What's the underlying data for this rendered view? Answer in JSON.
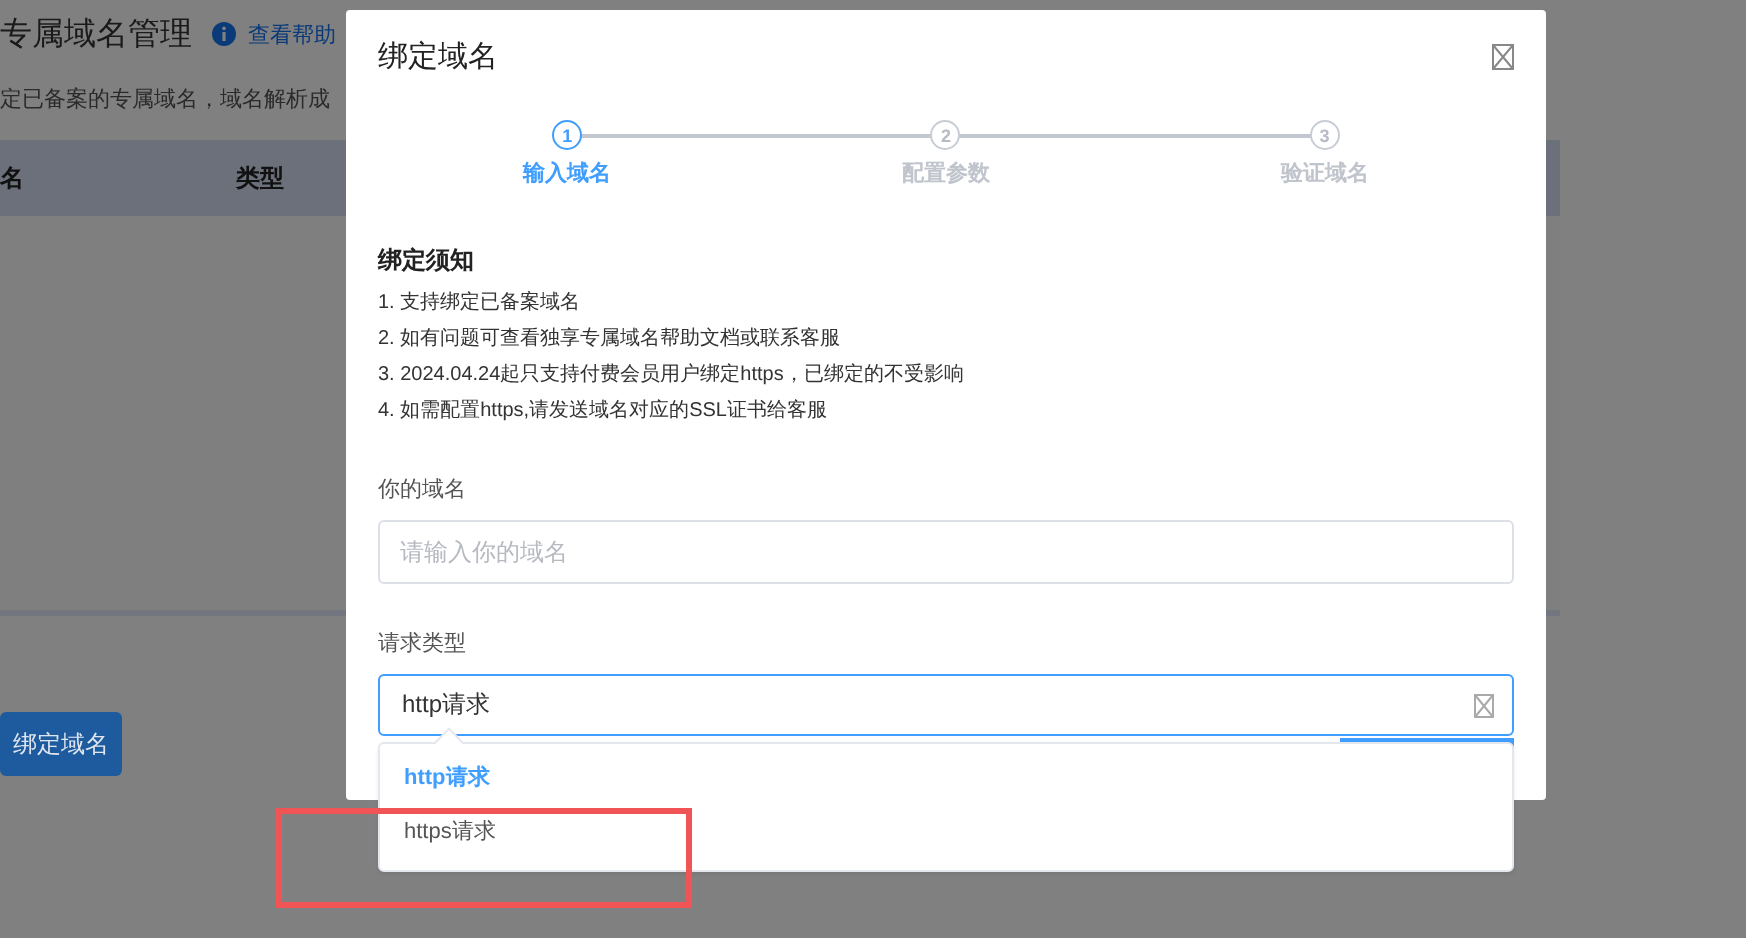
{
  "page": {
    "title": "专属域名管理",
    "help_link": "查看帮助",
    "description": "定已备案的专属域名，域名解析成",
    "table": {
      "columns": [
        "名",
        "类型"
      ]
    },
    "bind_button": "绑定域名"
  },
  "dialog": {
    "title": "绑定域名",
    "steps": [
      {
        "number": "1",
        "label": "输入域名",
        "active": true
      },
      {
        "number": "2",
        "label": "配置参数",
        "active": false
      },
      {
        "number": "3",
        "label": "验证域名",
        "active": false
      }
    ],
    "notice": {
      "title": "绑定须知",
      "items": [
        "1. 支持绑定已备案域名",
        "2. 如有问题可查看独享专属域名帮助文档或联系客服",
        "3. 2024.04.24起只支持付费会员用户绑定https，已绑定的不受影响",
        "4. 如需配置https,请发送域名对应的SSL证书给客服"
      ]
    },
    "domain_field": {
      "label": "你的域名",
      "placeholder": "请输入你的域名"
    },
    "type_field": {
      "label": "请求类型",
      "value": "http请求",
      "focused": true
    },
    "options": [
      {
        "label": "http请求",
        "selected": true
      },
      {
        "label": "https请求",
        "selected": false
      }
    ]
  }
}
